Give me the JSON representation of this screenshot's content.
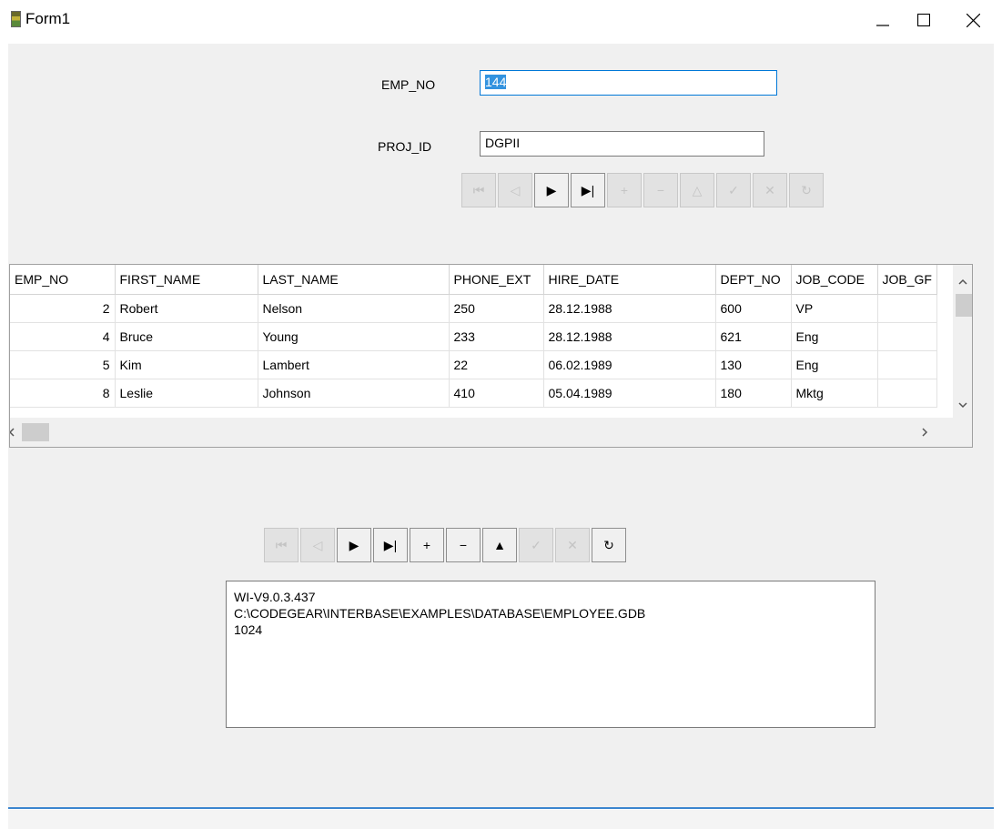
{
  "window": {
    "title": "Form1"
  },
  "form": {
    "emp_no_label": "EMP_NO",
    "emp_no_value": "144",
    "proj_id_label": "PROJ_ID",
    "proj_id_value": "DGPII"
  },
  "navigator_top": {
    "buttons": [
      {
        "name": "first",
        "glyph": "⏮",
        "enabled": false
      },
      {
        "name": "prior",
        "glyph": "◁",
        "enabled": false
      },
      {
        "name": "next",
        "glyph": "▶",
        "enabled": true
      },
      {
        "name": "last",
        "glyph": "▶|",
        "enabled": true
      },
      {
        "name": "insert",
        "glyph": "+",
        "enabled": false
      },
      {
        "name": "delete",
        "glyph": "−",
        "enabled": false
      },
      {
        "name": "edit",
        "glyph": "△",
        "enabled": false
      },
      {
        "name": "post",
        "glyph": "✓",
        "enabled": false
      },
      {
        "name": "cancel",
        "glyph": "✕",
        "enabled": false
      },
      {
        "name": "refresh",
        "glyph": "↻",
        "enabled": false
      }
    ]
  },
  "navigator_bottom": {
    "buttons": [
      {
        "name": "first",
        "glyph": "⏮",
        "enabled": false
      },
      {
        "name": "prior",
        "glyph": "◁",
        "enabled": false
      },
      {
        "name": "next",
        "glyph": "▶",
        "enabled": true
      },
      {
        "name": "last",
        "glyph": "▶|",
        "enabled": true
      },
      {
        "name": "insert",
        "glyph": "+",
        "enabled": true
      },
      {
        "name": "delete",
        "glyph": "−",
        "enabled": true
      },
      {
        "name": "edit",
        "glyph": "▲",
        "enabled": true
      },
      {
        "name": "post",
        "glyph": "✓",
        "enabled": false
      },
      {
        "name": "cancel",
        "glyph": "✕",
        "enabled": false
      },
      {
        "name": "refresh",
        "glyph": "↻",
        "enabled": true
      }
    ]
  },
  "grid": {
    "columns": [
      "EMP_NO",
      "FIRST_NAME",
      "LAST_NAME",
      "PHONE_EXT",
      "HIRE_DATE",
      "DEPT_NO",
      "JOB_CODE",
      "JOB_GF"
    ],
    "rows": [
      [
        "2",
        "Robert",
        "Nelson",
        "250",
        "28.12.1988",
        "600",
        "VP",
        ""
      ],
      [
        "4",
        "Bruce",
        "Young",
        "233",
        "28.12.1988",
        "621",
        "Eng",
        ""
      ],
      [
        "5",
        "Kim",
        "Lambert",
        "22",
        "06.02.1989",
        "130",
        "Eng",
        ""
      ],
      [
        "8",
        "Leslie",
        "Johnson",
        "410",
        "05.04.1989",
        "180",
        "Mktg",
        ""
      ]
    ]
  },
  "memo": {
    "lines": [
      "WI-V9.0.3.437",
      "C:\\CODEGEAR\\INTERBASE\\EXAMPLES\\DATABASE\\EMPLOYEE.GDB",
      "1024"
    ]
  }
}
